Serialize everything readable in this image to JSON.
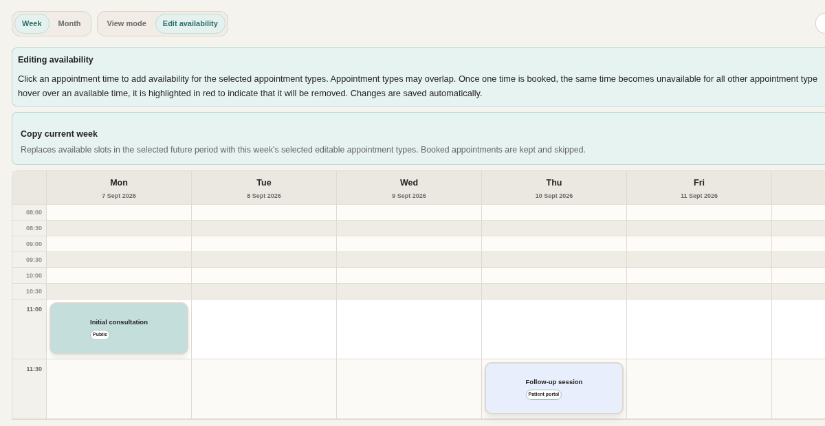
{
  "range_toggle": [
    {
      "label": "Week",
      "selected": true
    },
    {
      "label": "Month",
      "selected": false
    }
  ],
  "mode_toggle": [
    {
      "label": "View mode",
      "selected": false
    },
    {
      "label": "Edit availability",
      "selected": true
    }
  ],
  "info_panel": {
    "title": "Editing availability",
    "lines": [
      "Click an appointment time to add availability for the selected appointment types. Appointment types may overlap. Once one time is booked, the same time becomes unavailable for all other appointment type",
      "hover over an available time, it is highlighted in red to indicate that it will be removed. Changes are saved automatically."
    ]
  },
  "copy_panel": {
    "title": "Copy current week",
    "description": "Replaces available slots in the selected future period with this week's selected editable appointment types. Booked appointments are kept and skipped."
  },
  "calendar": {
    "days": [
      {
        "name": "Mon",
        "date": "7 Sept 2026"
      },
      {
        "name": "Tue",
        "date": "8 Sept 2026"
      },
      {
        "name": "Wed",
        "date": "9 Sept 2026"
      },
      {
        "name": "Thu",
        "date": "10 Sept 2026"
      },
      {
        "name": "Fri",
        "date": "11 Sept 2026"
      }
    ],
    "slots": [
      {
        "time": "08:00",
        "kind": "compact",
        "cells": [
          {},
          {},
          {},
          {},
          {},
          {}
        ]
      },
      {
        "time": "08:30",
        "kind": "compact",
        "cells": [
          {},
          {},
          {},
          {},
          {},
          {}
        ]
      },
      {
        "time": "09:00",
        "kind": "compact",
        "cells": [
          {},
          {},
          {},
          {},
          {},
          {}
        ]
      },
      {
        "time": "09:30",
        "kind": "compact",
        "cells": [
          {},
          {},
          {},
          {},
          {},
          {}
        ]
      },
      {
        "time": "10:00",
        "kind": "compact",
        "cells": [
          {},
          {},
          {},
          {},
          {},
          {}
        ]
      },
      {
        "time": "10:30",
        "kind": "compact",
        "cells": [
          {},
          {},
          {},
          {},
          {},
          {}
        ]
      },
      {
        "time": "11:00",
        "kind": "tall",
        "cells": [
          {
            "appointment": {
              "title": "Initial consultation",
              "tag": "Public",
              "color": "#c4dedb"
            }
          },
          {},
          {},
          {},
          {},
          {}
        ]
      },
      {
        "time": "11:30",
        "kind": "tall",
        "cells": [
          {},
          {},
          {},
          {
            "appointment": {
              "title": "Follow-up session",
              "tag": "Patient portal",
              "color": "#e8eefc"
            }
          },
          {},
          {}
        ]
      }
    ]
  }
}
